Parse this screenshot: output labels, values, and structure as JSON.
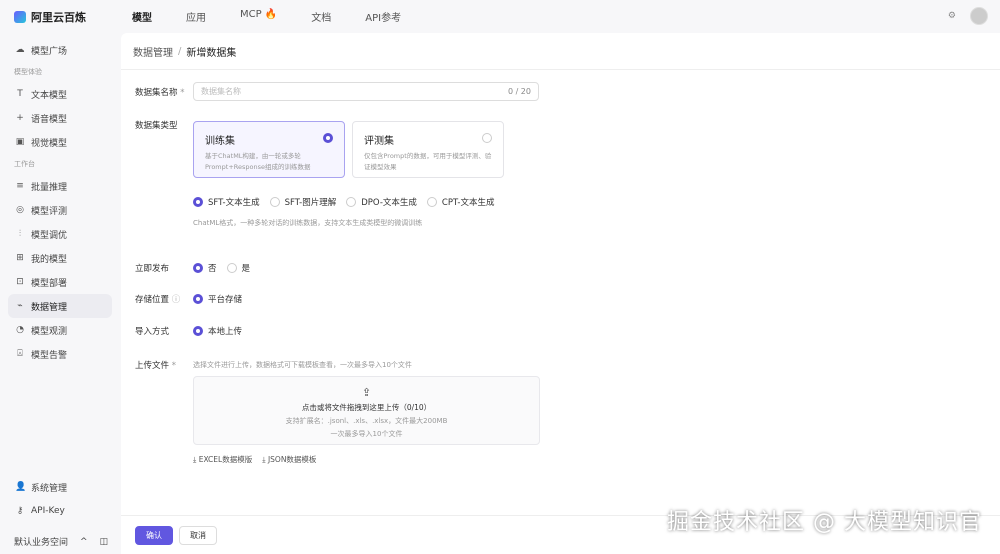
{
  "app": {
    "name": "阿里云百炼"
  },
  "nav": [
    "模型",
    "应用",
    "MCP 🔥",
    "文档",
    "API参考"
  ],
  "sidebar": {
    "top": {
      "label": "模型广场",
      "icon": "cloud-icon"
    },
    "group1": "模型体验",
    "g1": [
      {
        "label": "文本模型",
        "icon": "T"
      },
      {
        "label": "语音模型",
        "icon": "+"
      },
      {
        "label": "视觉模型",
        "icon": "▣"
      }
    ],
    "group2": "工作台",
    "g2": [
      {
        "label": "批量推理",
        "icon": "≡"
      },
      {
        "label": "模型评测",
        "icon": "◎"
      },
      {
        "label": "模型调优",
        "icon": "⫶"
      },
      {
        "label": "我的模型",
        "icon": "⊞"
      },
      {
        "label": "模型部署",
        "icon": "⊡"
      },
      {
        "label": "数据管理",
        "icon": "⌁"
      },
      {
        "label": "模型观测",
        "icon": "◔"
      },
      {
        "label": "模型告警",
        "icon": "⍓"
      }
    ],
    "bottom": [
      {
        "label": "系统管理",
        "icon": "👤"
      },
      {
        "label": "API-Key",
        "icon": "⚷"
      }
    ],
    "workspace": "默认业务空间"
  },
  "breadcrumb": {
    "parent": "数据管理",
    "sep": "/",
    "current": "新增数据集"
  },
  "form": {
    "name_label": "数据集名称",
    "required": "*",
    "name_placeholder": "数据集名称",
    "name_count": "0 / 20",
    "type_label": "数据集类型",
    "cards": [
      {
        "title": "训练集",
        "desc": "基于ChatML构建，由一轮或多轮Prompt+Response组成的训练数据",
        "selected": true
      },
      {
        "title": "评测集",
        "desc": "仅包含Prompt的数据，可用于模型评测、验证模型效果",
        "selected": false
      }
    ],
    "subtypes": [
      {
        "label": "SFT-文本生成",
        "selected": true
      },
      {
        "label": "SFT-图片理解",
        "selected": false
      },
      {
        "label": "DPO-文本生成",
        "selected": false
      },
      {
        "label": "CPT-文本生成",
        "selected": false
      }
    ],
    "subtype_hint": "ChatML格式，一种多轮对话的训练数据，支持文本生成类模型的微调训练",
    "publish_label": "立即发布",
    "publish_options": [
      {
        "label": "否",
        "selected": true
      },
      {
        "label": "是",
        "selected": false
      }
    ],
    "storage_label": "存储位置",
    "storage_option": "平台存储",
    "import_label": "导入方式",
    "import_option": "本地上传",
    "upload_label": "上传文件",
    "upload_hint": "选择文件进行上传，数据格式可下载模板查看，一次最多导入10个文件",
    "drop_title": "点击或将文件拖拽到这里上传（0/10）",
    "drop_ext": "支持扩展名：.jsonl、.xls、.xlsx，文件最大200MB",
    "drop_limit": "一次最多导入10个文件",
    "templates": [
      "EXCEL数据模版",
      "JSON数据模板"
    ]
  },
  "footer": {
    "confirm": "确认",
    "cancel": "取消"
  },
  "watermark": "掘金技术社区 @ 大模型知识官",
  "colors": {
    "accent": "#6157e0"
  }
}
